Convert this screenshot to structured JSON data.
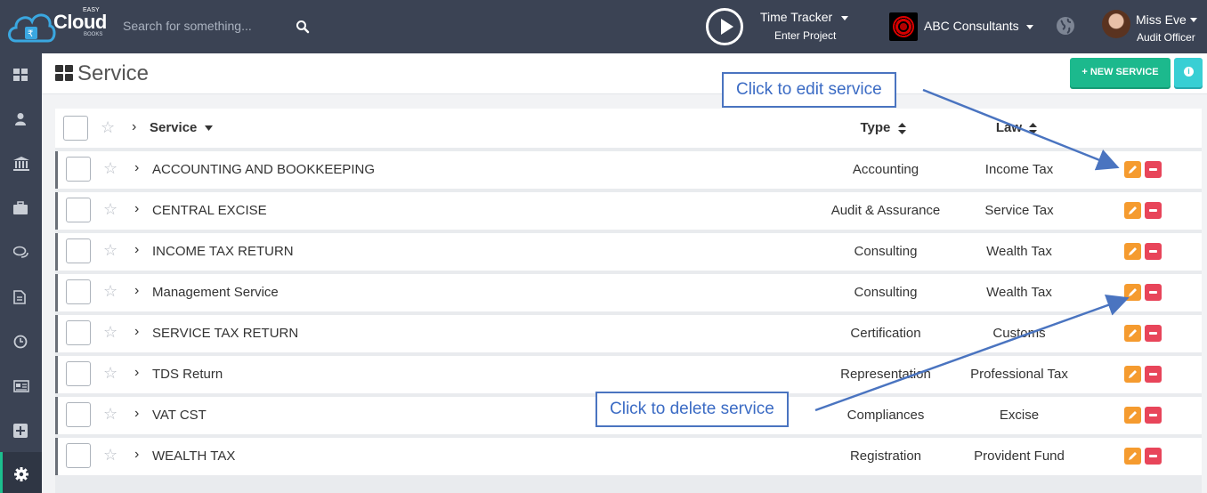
{
  "app": {
    "logo": {
      "easy": "EASY",
      "cloud": "Cloud",
      "books": "BOOKS"
    },
    "search_placeholder": "Search for something...",
    "time_tracker": {
      "title": "Time Tracker",
      "subtitle": "Enter Project"
    },
    "company": "ABC Consultants",
    "user": {
      "name": "Miss Eve",
      "role": "Audit Officer"
    }
  },
  "sidebar": {
    "items": [
      {
        "icon": "dashboard-icon"
      },
      {
        "icon": "user-icon"
      },
      {
        "icon": "bank-icon"
      },
      {
        "icon": "briefcase-icon"
      },
      {
        "icon": "chat-icon"
      },
      {
        "icon": "document-icon"
      },
      {
        "icon": "clock-icon"
      },
      {
        "icon": "newspaper-icon"
      },
      {
        "icon": "plus-square-icon"
      },
      {
        "icon": "gear-icon",
        "active": true
      }
    ]
  },
  "page": {
    "title": "Service",
    "new_button": "+ NEW SERVICE"
  },
  "table": {
    "headers": {
      "service": "Service",
      "type": "Type",
      "law": "Law"
    },
    "rows": [
      {
        "service": "ACCOUNTING AND BOOKKEEPING",
        "type": "Accounting",
        "law": "Income Tax"
      },
      {
        "service": "CENTRAL EXCISE",
        "type": "Audit & Assurance",
        "law": "Service Tax"
      },
      {
        "service": "INCOME TAX RETURN",
        "type": "Consulting",
        "law": "Wealth Tax"
      },
      {
        "service": "Management Service",
        "type": "Consulting",
        "law": "Wealth Tax"
      },
      {
        "service": "SERVICE TAX RETURN",
        "type": "Certification",
        "law": "Customs"
      },
      {
        "service": "TDS Return",
        "type": "Representation",
        "law": "Professional Tax"
      },
      {
        "service": "VAT CST",
        "type": "Compliances",
        "law": "Excise"
      },
      {
        "service": "WEALTH TAX",
        "type": "Registration",
        "law": "Provident Fund"
      }
    ]
  },
  "callouts": {
    "edit": "Click to edit service",
    "delete": "Click to delete service"
  },
  "colors": {
    "topbar": "#3b4354",
    "new_button": "#1cb98d",
    "info_button": "#38cfd4",
    "edit_button": "#f59b2f",
    "delete_button": "#e8455a",
    "callout_border": "#4a74c0"
  }
}
